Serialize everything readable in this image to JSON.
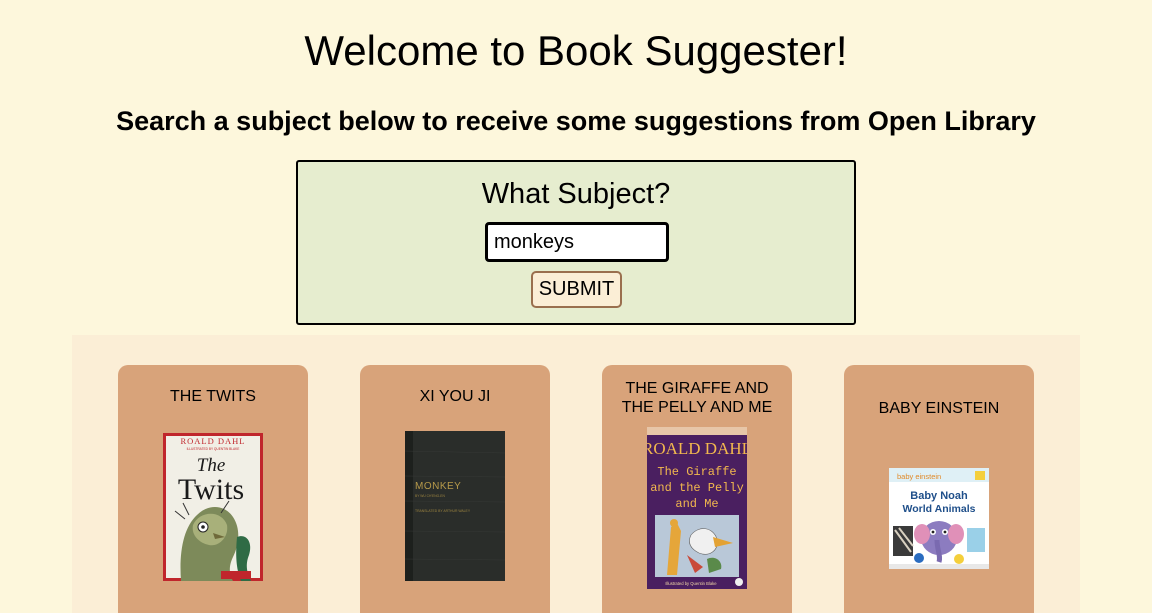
{
  "header": {
    "title": "Welcome to Book Suggester!",
    "subtitle": "Search a subject below to receive some suggestions from Open Library"
  },
  "search": {
    "label": "What Subject?",
    "value": "monkeys",
    "submit_label": "SUBMIT"
  },
  "results": [
    {
      "title": "THE TWITS",
      "cover_author": "ROALD DAHL",
      "cover_illustrator": "ILLUSTRATED BY QUENTIN BLAKE",
      "cover_title_1": "The",
      "cover_title_2": "Twits"
    },
    {
      "title": "XI YOU JI",
      "cover_title": "MONKEY",
      "cover_author": "BY WU CH'ENG-EN",
      "cover_translator": "TRANSLATED BY ARTHUR WALEY"
    },
    {
      "title": "THE GIRAFFE AND THE PELLY AND ME",
      "cover_author": "ROALD DAHL",
      "cover_title_1": "The Giraffe",
      "cover_title_2": "and the Pelly",
      "cover_title_3": "and Me",
      "cover_illustrator": "Illustrated by Quentin Blake"
    },
    {
      "title": "BABY EINSTEIN",
      "cover_brand": "baby einstein",
      "cover_title_1": "Baby Noah",
      "cover_title_2": "World Animals"
    }
  ],
  "colors": {
    "page_bg": "#fdf7dc",
    "search_bg": "#e6edcf",
    "results_bg": "#fbeed6",
    "card_bg": "#d8a37a"
  }
}
